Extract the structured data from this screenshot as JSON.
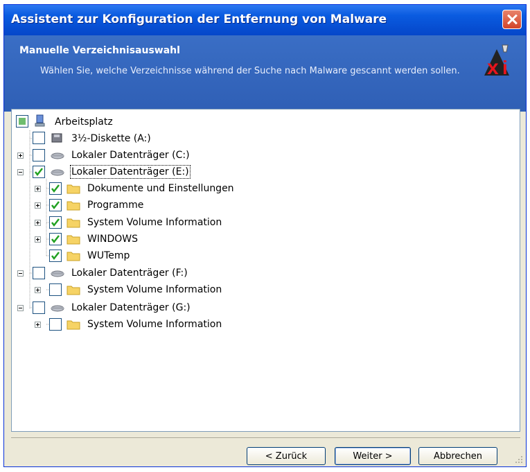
{
  "window": {
    "title": "Assistent zur Konfiguration der Entfernung von Malware"
  },
  "header": {
    "title": "Manuelle Verzeichnisauswahl",
    "description": "Wählen Sie, welche Verzeichnisse während der Suche nach Malware gescannt werden sollen."
  },
  "tree": {
    "root": {
      "label": "Arbeitsplatz",
      "state": "partial"
    },
    "floppy": {
      "label": "3½-Diskette (A:)",
      "state": "unchecked"
    },
    "drive_c": {
      "label": "Lokaler Datenträger (C:)",
      "state": "unchecked",
      "expanded": false
    },
    "drive_e": {
      "label": "Lokaler Datenträger (E:)",
      "state": "checked",
      "expanded": true
    },
    "e_folders": [
      {
        "label": "Dokumente und Einstellungen",
        "state": "checked"
      },
      {
        "label": "Programme",
        "state": "checked"
      },
      {
        "label": "System Volume Information",
        "state": "checked"
      },
      {
        "label": "WINDOWS",
        "state": "checked"
      },
      {
        "label": "WUTemp",
        "state": "checked"
      }
    ],
    "drive_f": {
      "label": "Lokaler Datenträger (F:)",
      "state": "unchecked",
      "expanded": true
    },
    "f_folders": [
      {
        "label": "System Volume Information",
        "state": "unchecked"
      }
    ],
    "drive_g": {
      "label": "Lokaler Datenträger (G:)",
      "state": "unchecked",
      "expanded": true
    },
    "g_folders": [
      {
        "label": "System Volume Information",
        "state": "unchecked"
      }
    ]
  },
  "buttons": {
    "back": "< Zurück",
    "next": "Weiter >",
    "cancel": "Abbrechen"
  },
  "colors": {
    "titlebar": "#0a5be0",
    "header": "#3a6ec5",
    "check": "#21a121",
    "window_bg": "#ece9d8"
  }
}
